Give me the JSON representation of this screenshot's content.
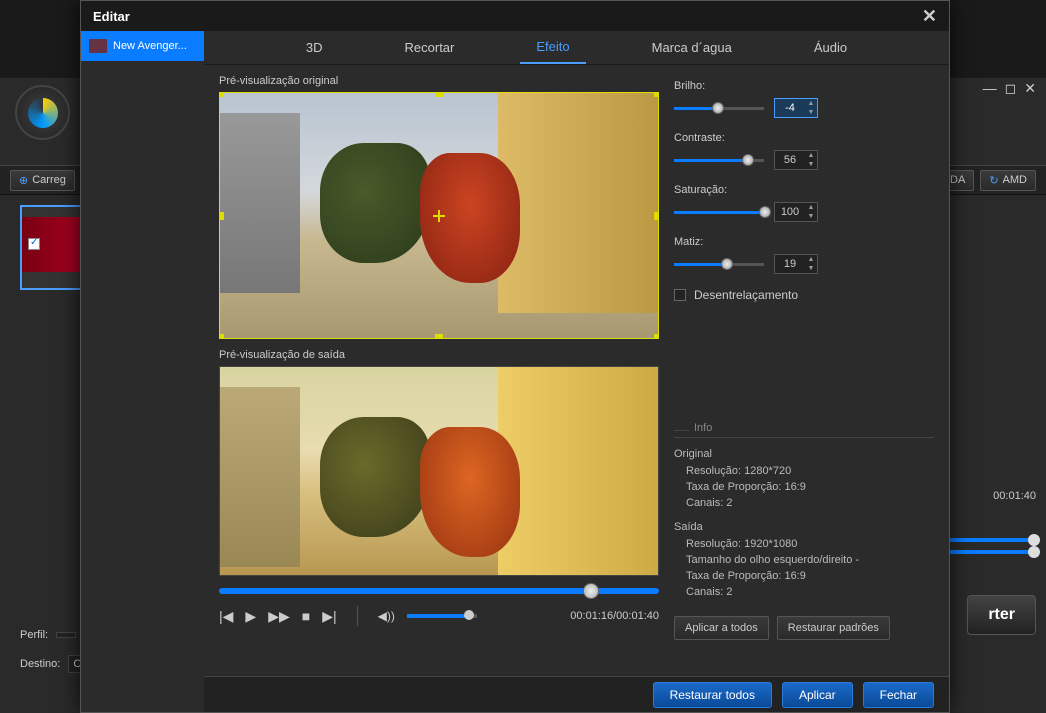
{
  "bg": {
    "load_btn": "Carreg",
    "cuda": "JDA",
    "amd": "AMD",
    "time": "00:01:40",
    "convert": "rter",
    "profile_label": "Perfil:",
    "dest_label": "Destino:",
    "dest_val": "C:"
  },
  "modal": {
    "title": "Editar",
    "sidebar_item": "New Avenger...",
    "tabs": {
      "t3d": "3D",
      "crop": "Recortar",
      "effect": "Efeito",
      "watermark": "Marca d´agua",
      "audio": "Áudio"
    },
    "preview_original": "Pré-visualização original",
    "preview_output": "Pré-visualização de saída",
    "playback_time": "00:01:16/00:01:40",
    "sliders": {
      "brightness": {
        "label": "Brilho:",
        "value": "-4",
        "pct": 45
      },
      "contrast": {
        "label": "Contraste:",
        "value": "56",
        "pct": 78
      },
      "saturation": {
        "label": "Saturação:",
        "value": "100",
        "pct": 100
      },
      "hue": {
        "label": "Matiz:",
        "value": "19",
        "pct": 55
      }
    },
    "deinterlace": "Desentrelaçamento",
    "info": {
      "header": "Info",
      "original_title": "Original",
      "original_res": "Resolução: 1280*720",
      "original_ratio": "Taxa de Proporção: 16:9",
      "original_channels": "Canais: 2",
      "output_title": "Saída",
      "output_res": "Resolução: 1920*1080",
      "output_eye": "Tamanho do olho esquerdo/direito -",
      "output_ratio": "Taxa de Proporção: 16:9",
      "output_channels": "Canais: 2"
    },
    "apply_all": "Aplicar a todos",
    "restore_defaults": "Restaurar padrões",
    "footer": {
      "restore_all": "Restaurar todos",
      "apply": "Aplicar",
      "close": "Fechar"
    }
  }
}
